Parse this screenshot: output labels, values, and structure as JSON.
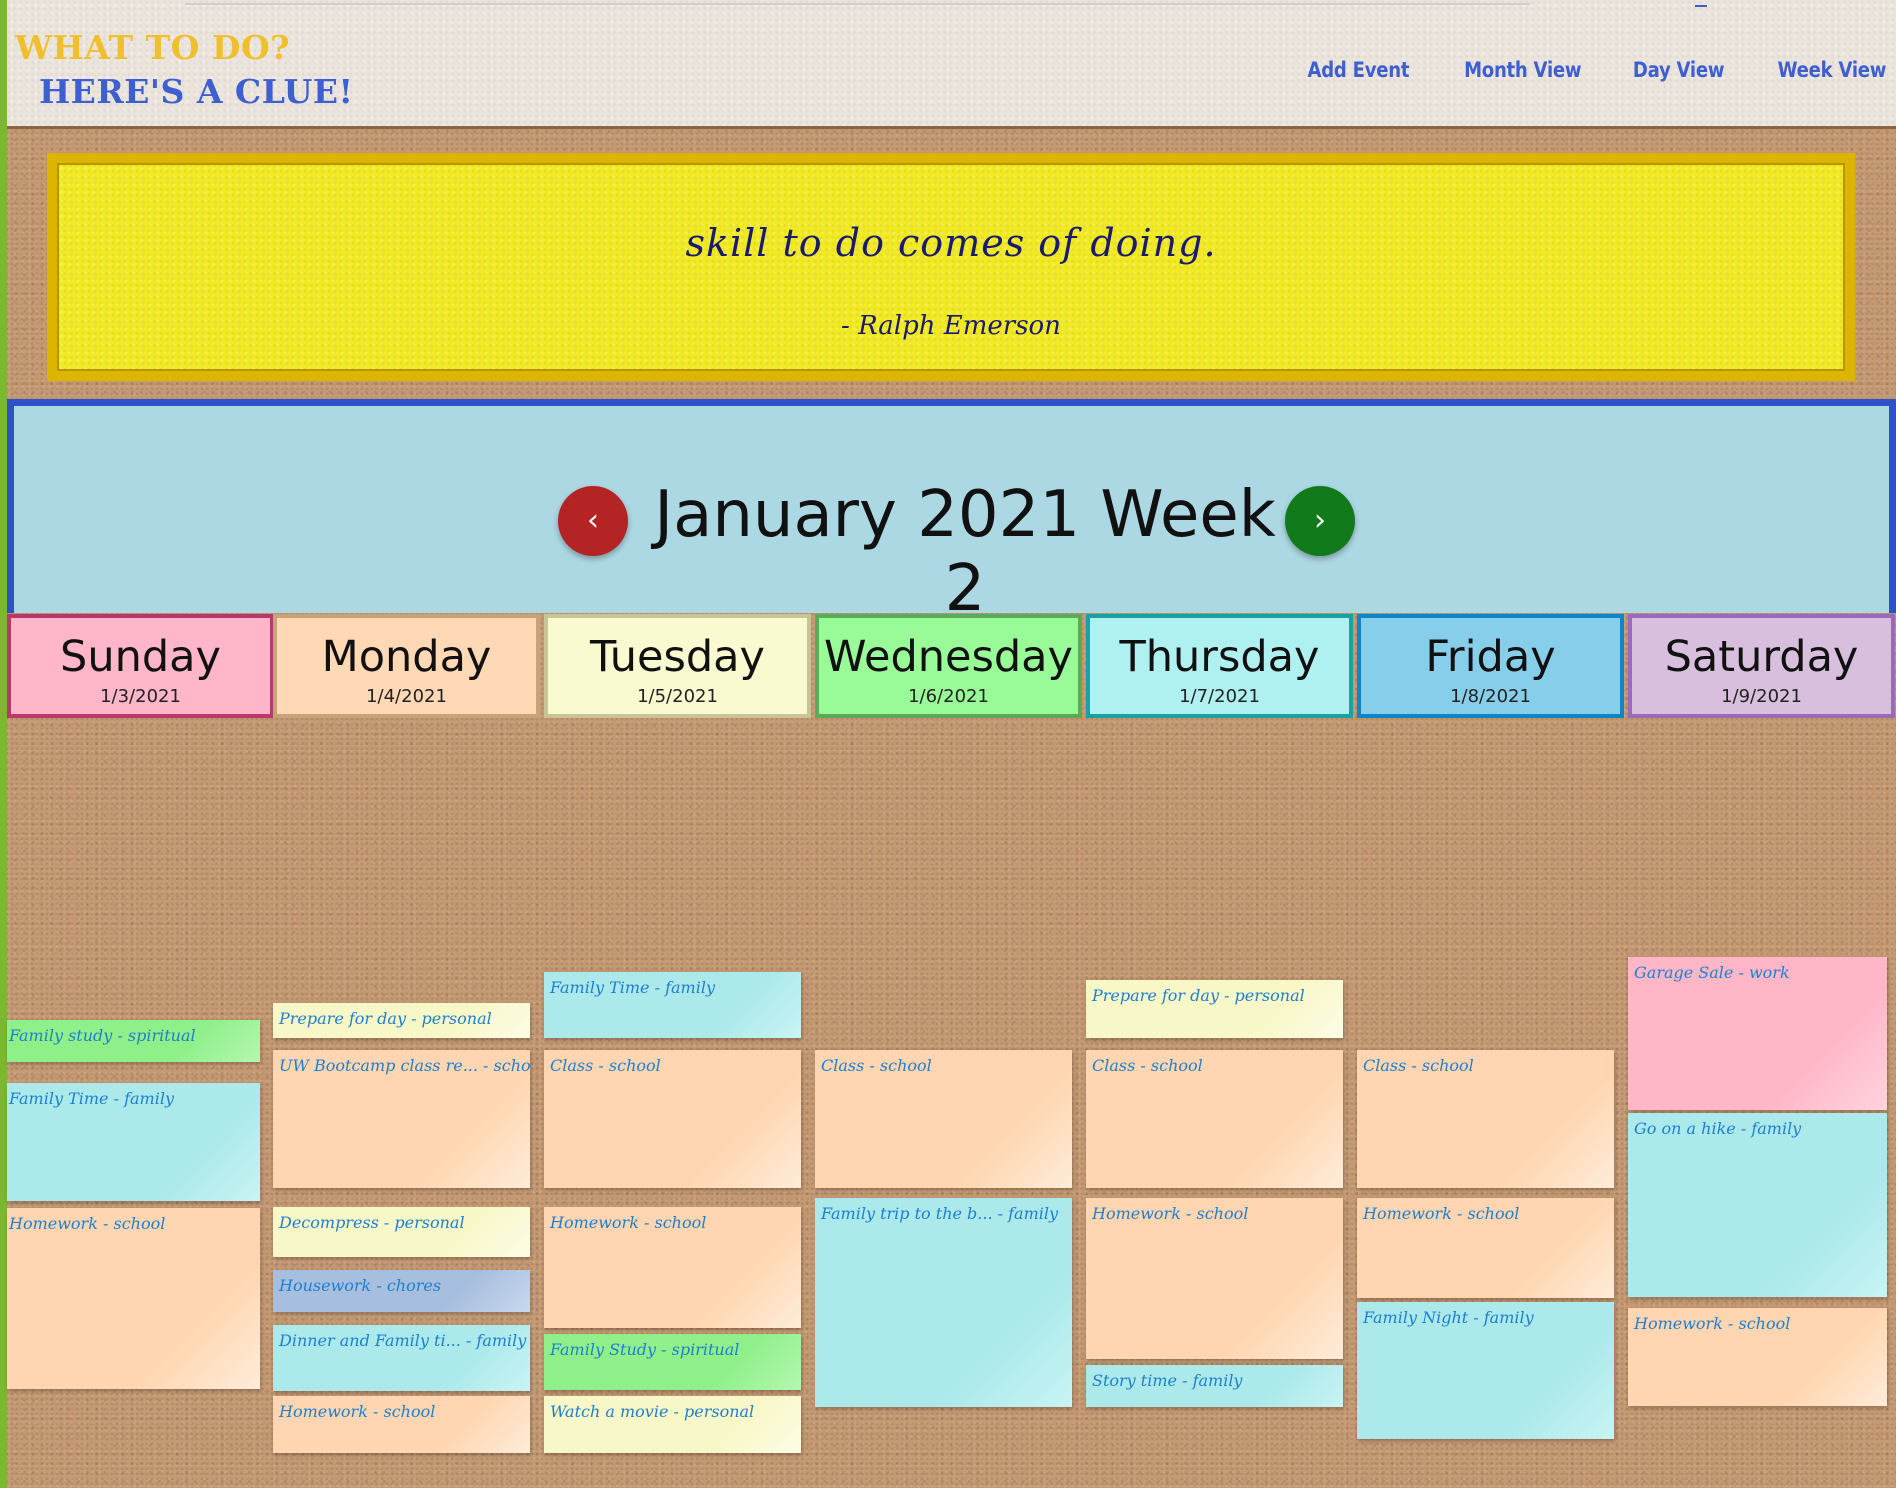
{
  "header": {
    "logo_line1": "WHAT TO DO?",
    "logo_line2": "HERE'S A CLUE!",
    "nav": [
      "Add Event",
      "Month View",
      "Day View",
      "Week View"
    ]
  },
  "quote": {
    "text": "skill to do comes of doing.",
    "author": "- Ralph Emerson"
  },
  "week_nav": {
    "title": "January 2021 Week 2",
    "prev_label": "‹",
    "next_label": "›"
  },
  "days": [
    {
      "name": "Sunday",
      "date": "1/3/2021"
    },
    {
      "name": "Monday",
      "date": "1/4/2021"
    },
    {
      "name": "Tuesday",
      "date": "1/5/2021"
    },
    {
      "name": "Wednesday",
      "date": "1/6/2021"
    },
    {
      "name": "Thursday",
      "date": "1/7/2021"
    },
    {
      "name": "Friday",
      "date": "1/8/2021"
    },
    {
      "name": "Saturday",
      "date": "1/9/2021"
    }
  ],
  "events": {
    "sunday": [
      {
        "label": "Family study - spiritual",
        "category": "spiritual"
      },
      {
        "label": "Family Time - family",
        "category": "family"
      },
      {
        "label": "Homework - school",
        "category": "school"
      }
    ],
    "monday": [
      {
        "label": "Prepare for day - personal",
        "category": "personal"
      },
      {
        "label": "UW Bootcamp class re... - school",
        "category": "school"
      },
      {
        "label": "Decompress - personal",
        "category": "personal"
      },
      {
        "label": "Housework - chores",
        "category": "chores"
      },
      {
        "label": "Dinner and Family ti... - family",
        "category": "family"
      },
      {
        "label": "Homework - school",
        "category": "school"
      }
    ],
    "tuesday": [
      {
        "label": "Family Time - family",
        "category": "family"
      },
      {
        "label": "Class - school",
        "category": "school"
      },
      {
        "label": "Homework - school",
        "category": "school"
      },
      {
        "label": "Family Study - spiritual",
        "category": "spiritual"
      },
      {
        "label": "Watch a movie - personal",
        "category": "personal"
      }
    ],
    "wednesday": [
      {
        "label": "Class - school",
        "category": "school"
      },
      {
        "label": "Family trip to the b... - family",
        "category": "family"
      }
    ],
    "thursday": [
      {
        "label": "Prepare for day - personal",
        "category": "personal"
      },
      {
        "label": "Class - school",
        "category": "school"
      },
      {
        "label": "Homework - school",
        "category": "school"
      },
      {
        "label": "Story time - family",
        "category": "family"
      }
    ],
    "friday": [
      {
        "label": "Class - school",
        "category": "school"
      },
      {
        "label": "Homework - school",
        "category": "school"
      },
      {
        "label": "Family Night - family",
        "category": "family"
      }
    ],
    "saturday": [
      {
        "label": "Garage Sale - work",
        "category": "work"
      },
      {
        "label": "Go on a hike - family",
        "category": "family"
      },
      {
        "label": "Homework - school",
        "category": "school"
      }
    ]
  },
  "colors": {
    "logo_yellow": "#f0bf2e",
    "logo_blue": "#3d5fd0",
    "quote_bg": "#f1ea23",
    "banner_bg": "#acd8e4",
    "prev_button": "#b52424",
    "next_button": "#117a1a",
    "event_text": "#1e7fcf",
    "day_colors": [
      "#ffb6c8",
      "#ffd8b5",
      "#fafad0",
      "#98fb98",
      "#aff0f0",
      "#87ceeb",
      "#d8bfdd"
    ],
    "category_colors": {
      "spiritual": "#8ff08a",
      "family": "#abe9eb",
      "school": "#ffd6b1",
      "personal": "#f8f7c8",
      "chores": "#a7bfde",
      "work": "#ffb7c8"
    }
  }
}
